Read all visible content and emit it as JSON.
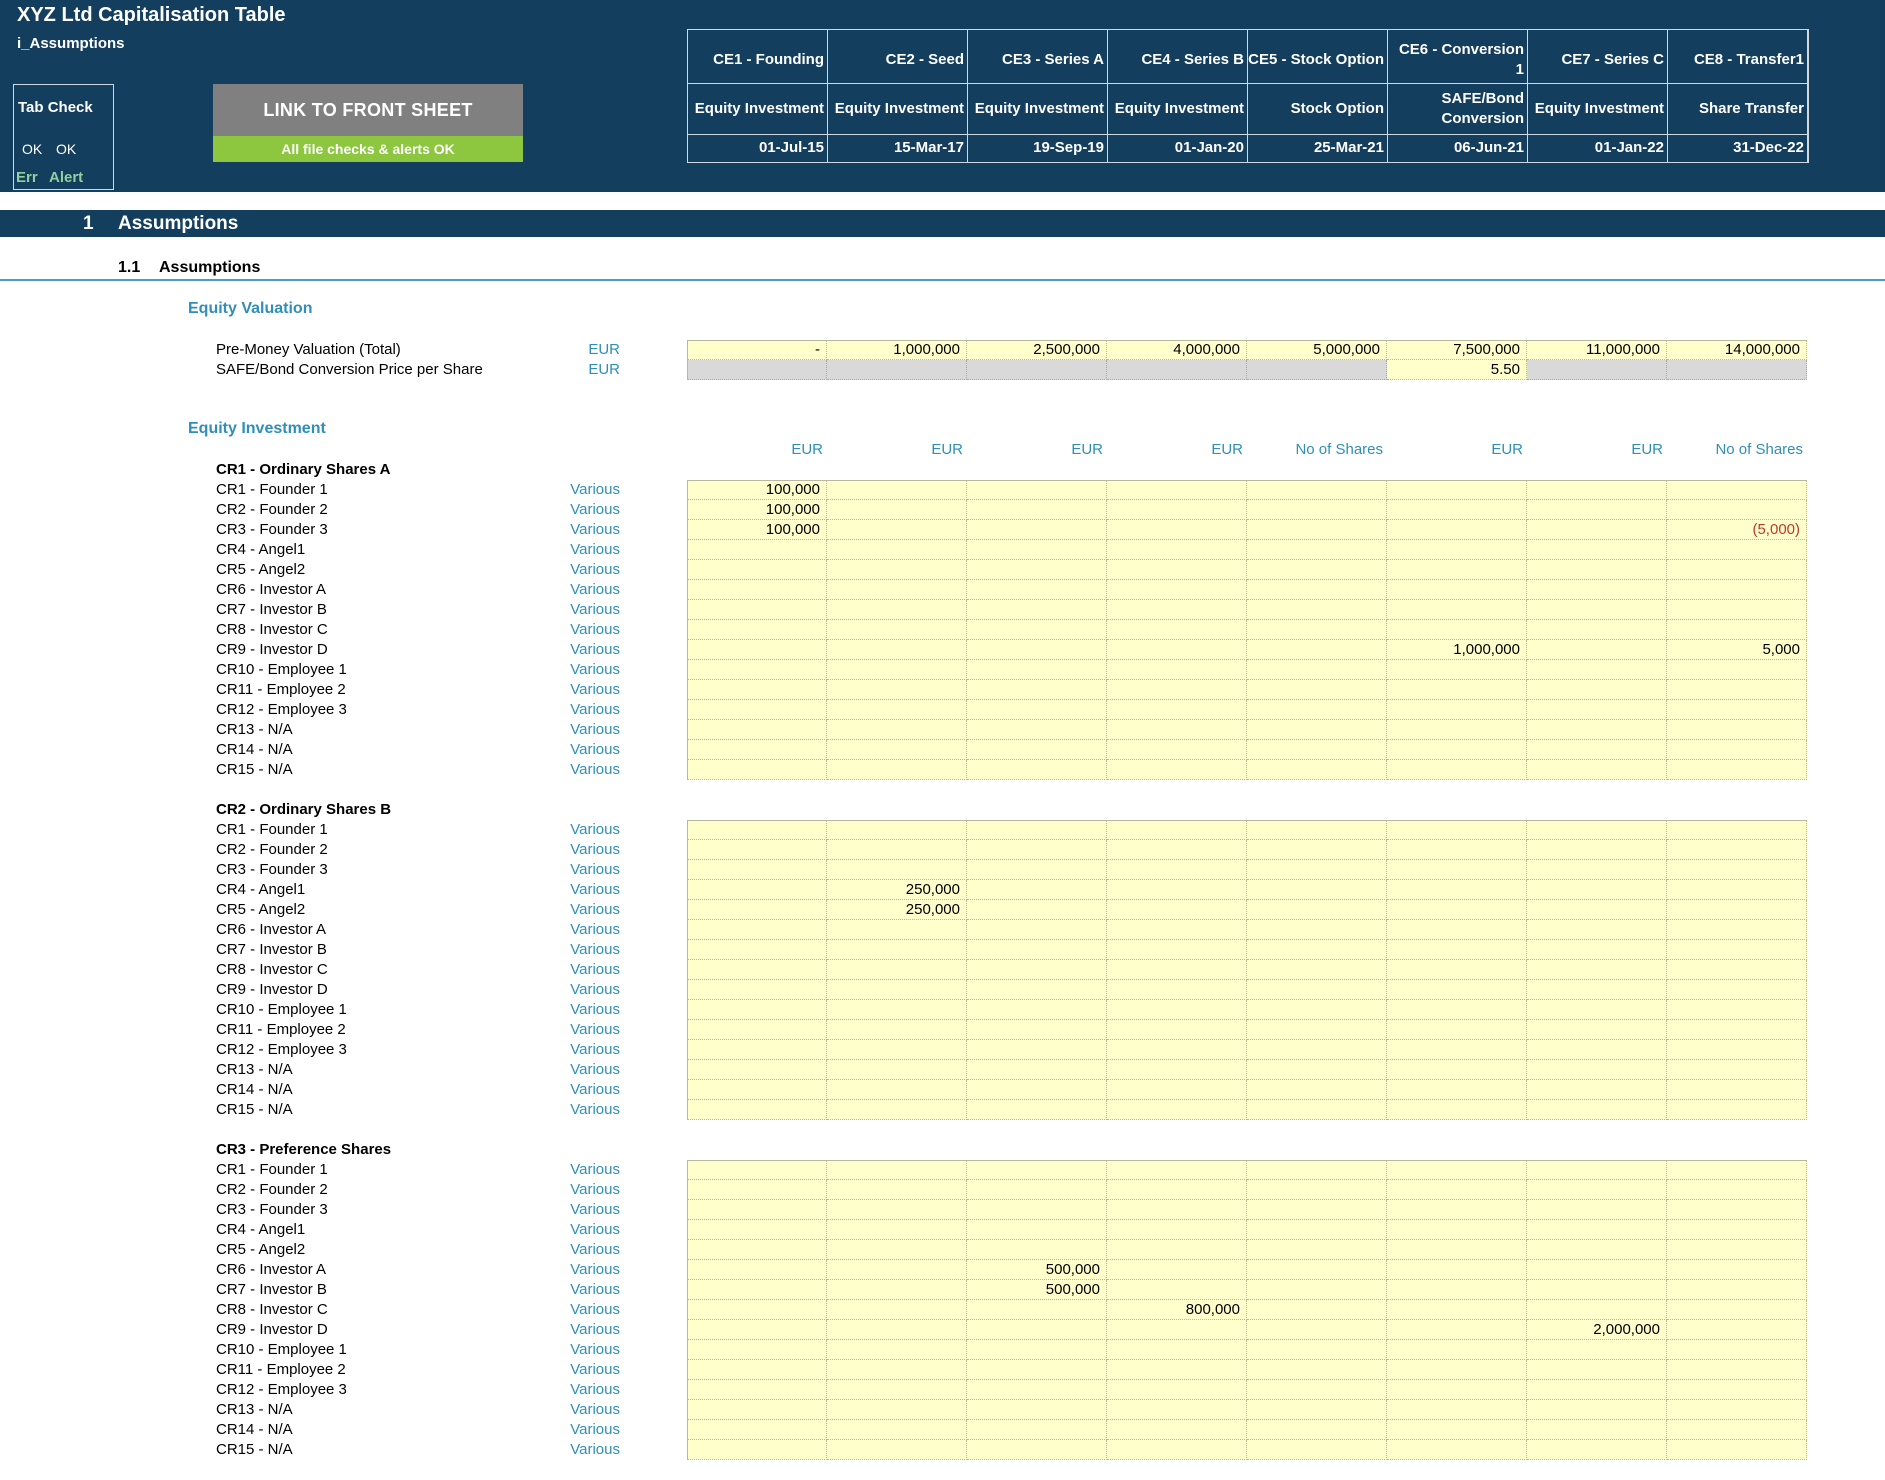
{
  "header": {
    "title": "XYZ Ltd Capitalisation Table",
    "subtitle": "i_Assumptions",
    "tab_check": {
      "label": "Tab Check",
      "ok1": "OK",
      "ok2": "OK",
      "err": "Err",
      "alert": "Alert"
    },
    "link_button": "LINK TO FRONT SHEET",
    "checks_status": "All file checks & alerts OK"
  },
  "events": [
    {
      "name": "CE1 - Founding",
      "type": "Equity Investment",
      "date": "01-Jul-15"
    },
    {
      "name": "CE2 - Seed",
      "type": "Equity Investment",
      "date": "15-Mar-17"
    },
    {
      "name": "CE3 - Series A",
      "type": "Equity Investment",
      "date": "19-Sep-19"
    },
    {
      "name": "CE4 - Series B",
      "type": "Equity Investment",
      "date": "01-Jan-20"
    },
    {
      "name": "CE5 - Stock Option",
      "type": "Stock Option",
      "date": "25-Mar-21"
    },
    {
      "name": "CE6 - Conversion\n1",
      "type": "SAFE/Bond\nConversion",
      "date": "06-Jun-21"
    },
    {
      "name": "CE7 - Series C",
      "type": "Equity Investment",
      "date": "01-Jan-22"
    },
    {
      "name": "CE8 - Transfer1",
      "type": "Share Transfer",
      "date": "31-Dec-22"
    }
  ],
  "section": {
    "number": "1",
    "title": "Assumptions",
    "sub_number": "1.1",
    "sub_title": "Assumptions"
  },
  "equity_valuation": {
    "title": "Equity Valuation",
    "rows": [
      {
        "label": "Pre-Money Valuation (Total)",
        "unit": "EUR",
        "values": [
          "-",
          "1,000,000",
          "2,500,000",
          "4,000,000",
          "5,000,000",
          "7,500,000",
          "11,000,000",
          "14,000,000"
        ]
      },
      {
        "label": "SAFE/Bond Conversion Price per Share",
        "unit": "EUR",
        "values": [
          "",
          "",
          "",
          "",
          "",
          "5.50",
          "",
          ""
        ],
        "grey": [
          true,
          true,
          true,
          true,
          true,
          false,
          true,
          true
        ]
      }
    ]
  },
  "equity_investment": {
    "title": "Equity Investment",
    "unit_headers": [
      "EUR",
      "EUR",
      "EUR",
      "EUR",
      "No of Shares",
      "EUR",
      "EUR",
      "No of Shares"
    ],
    "blocks": [
      {
        "title": "CR1 - Ordinary Shares A",
        "rows": [
          {
            "label": "CR1 - Founder 1",
            "unit": "Various",
            "values": [
              "100,000",
              "",
              "",
              "",
              "",
              "",
              "",
              ""
            ]
          },
          {
            "label": "CR2 - Founder 2",
            "unit": "Various",
            "values": [
              "100,000",
              "",
              "",
              "",
              "",
              "",
              "",
              ""
            ]
          },
          {
            "label": "CR3 - Founder 3",
            "unit": "Various",
            "values": [
              "100,000",
              "",
              "",
              "",
              "",
              "",
              "",
              "(5,000)"
            ]
          },
          {
            "label": "CR4 - Angel1",
            "unit": "Various",
            "values": [
              "",
              "",
              "",
              "",
              "",
              "",
              "",
              ""
            ]
          },
          {
            "label": "CR5 - Angel2",
            "unit": "Various",
            "values": [
              "",
              "",
              "",
              "",
              "",
              "",
              "",
              ""
            ]
          },
          {
            "label": "CR6 - Investor A",
            "unit": "Various",
            "values": [
              "",
              "",
              "",
              "",
              "",
              "",
              "",
              ""
            ]
          },
          {
            "label": "CR7 - Investor B",
            "unit": "Various",
            "values": [
              "",
              "",
              "",
              "",
              "",
              "",
              "",
              ""
            ]
          },
          {
            "label": "CR8 - Investor C",
            "unit": "Various",
            "values": [
              "",
              "",
              "",
              "",
              "",
              "",
              "",
              ""
            ]
          },
          {
            "label": "CR9 - Investor D",
            "unit": "Various",
            "values": [
              "",
              "",
              "",
              "",
              "",
              "1,000,000",
              "",
              "5,000"
            ]
          },
          {
            "label": "CR10 - Employee 1",
            "unit": "Various",
            "values": [
              "",
              "",
              "",
              "",
              "",
              "",
              "",
              ""
            ]
          },
          {
            "label": "CR11 - Employee 2",
            "unit": "Various",
            "values": [
              "",
              "",
              "",
              "",
              "",
              "",
              "",
              ""
            ]
          },
          {
            "label": "CR12 - Employee 3",
            "unit": "Various",
            "values": [
              "",
              "",
              "",
              "",
              "",
              "",
              "",
              ""
            ]
          },
          {
            "label": "CR13 - N/A",
            "unit": "Various",
            "values": [
              "",
              "",
              "",
              "",
              "",
              "",
              "",
              ""
            ]
          },
          {
            "label": "CR14 - N/A",
            "unit": "Various",
            "values": [
              "",
              "",
              "",
              "",
              "",
              "",
              "",
              ""
            ]
          },
          {
            "label": "CR15 - N/A",
            "unit": "Various",
            "values": [
              "",
              "",
              "",
              "",
              "",
              "",
              "",
              ""
            ]
          }
        ]
      },
      {
        "title": "CR2 - Ordinary Shares B",
        "rows": [
          {
            "label": "CR1 - Founder 1",
            "unit": "Various",
            "values": [
              "",
              "",
              "",
              "",
              "",
              "",
              "",
              ""
            ]
          },
          {
            "label": "CR2 - Founder 2",
            "unit": "Various",
            "values": [
              "",
              "",
              "",
              "",
              "",
              "",
              "",
              ""
            ]
          },
          {
            "label": "CR3 - Founder 3",
            "unit": "Various",
            "values": [
              "",
              "",
              "",
              "",
              "",
              "",
              "",
              ""
            ]
          },
          {
            "label": "CR4 - Angel1",
            "unit": "Various",
            "values": [
              "",
              "250,000",
              "",
              "",
              "",
              "",
              "",
              ""
            ]
          },
          {
            "label": "CR5 - Angel2",
            "unit": "Various",
            "values": [
              "",
              "250,000",
              "",
              "",
              "",
              "",
              "",
              ""
            ]
          },
          {
            "label": "CR6 - Investor A",
            "unit": "Various",
            "values": [
              "",
              "",
              "",
              "",
              "",
              "",
              "",
              ""
            ]
          },
          {
            "label": "CR7 - Investor B",
            "unit": "Various",
            "values": [
              "",
              "",
              "",
              "",
              "",
              "",
              "",
              ""
            ]
          },
          {
            "label": "CR8 - Investor C",
            "unit": "Various",
            "values": [
              "",
              "",
              "",
              "",
              "",
              "",
              "",
              ""
            ]
          },
          {
            "label": "CR9 - Investor D",
            "unit": "Various",
            "values": [
              "",
              "",
              "",
              "",
              "",
              "",
              "",
              ""
            ]
          },
          {
            "label": "CR10 - Employee 1",
            "unit": "Various",
            "values": [
              "",
              "",
              "",
              "",
              "",
              "",
              "",
              ""
            ]
          },
          {
            "label": "CR11 - Employee 2",
            "unit": "Various",
            "values": [
              "",
              "",
              "",
              "",
              "",
              "",
              "",
              ""
            ]
          },
          {
            "label": "CR12 - Employee 3",
            "unit": "Various",
            "values": [
              "",
              "",
              "",
              "",
              "",
              "",
              "",
              ""
            ]
          },
          {
            "label": "CR13 - N/A",
            "unit": "Various",
            "values": [
              "",
              "",
              "",
              "",
              "",
              "",
              "",
              ""
            ]
          },
          {
            "label": "CR14 - N/A",
            "unit": "Various",
            "values": [
              "",
              "",
              "",
              "",
              "",
              "",
              "",
              ""
            ]
          },
          {
            "label": "CR15 - N/A",
            "unit": "Various",
            "values": [
              "",
              "",
              "",
              "",
              "",
              "",
              "",
              ""
            ]
          }
        ]
      },
      {
        "title": "CR3 - Preference Shares",
        "rows": [
          {
            "label": "CR1 - Founder 1",
            "unit": "Various",
            "values": [
              "",
              "",
              "",
              "",
              "",
              "",
              "",
              ""
            ]
          },
          {
            "label": "CR2 - Founder 2",
            "unit": "Various",
            "values": [
              "",
              "",
              "",
              "",
              "",
              "",
              "",
              ""
            ]
          },
          {
            "label": "CR3 - Founder 3",
            "unit": "Various",
            "values": [
              "",
              "",
              "",
              "",
              "",
              "",
              "",
              ""
            ]
          },
          {
            "label": "CR4 - Angel1",
            "unit": "Various",
            "values": [
              "",
              "",
              "",
              "",
              "",
              "",
              "",
              ""
            ]
          },
          {
            "label": "CR5 - Angel2",
            "unit": "Various",
            "values": [
              "",
              "",
              "",
              "",
              "",
              "",
              "",
              ""
            ]
          },
          {
            "label": "CR6 - Investor A",
            "unit": "Various",
            "values": [
              "",
              "",
              "500,000",
              "",
              "",
              "",
              "",
              ""
            ]
          },
          {
            "label": "CR7 - Investor B",
            "unit": "Various",
            "values": [
              "",
              "",
              "500,000",
              "",
              "",
              "",
              "",
              ""
            ]
          },
          {
            "label": "CR8 - Investor C",
            "unit": "Various",
            "values": [
              "",
              "",
              "",
              "800,000",
              "",
              "",
              "",
              ""
            ]
          },
          {
            "label": "CR9 - Investor D",
            "unit": "Various",
            "values": [
              "",
              "",
              "",
              "",
              "",
              "",
              "2,000,000",
              ""
            ]
          },
          {
            "label": "CR10 - Employee 1",
            "unit": "Various",
            "values": [
              "",
              "",
              "",
              "",
              "",
              "",
              "",
              ""
            ]
          },
          {
            "label": "CR11 - Employee 2",
            "unit": "Various",
            "values": [
              "",
              "",
              "",
              "",
              "",
              "",
              "",
              ""
            ]
          },
          {
            "label": "CR12 - Employee 3",
            "unit": "Various",
            "values": [
              "",
              "",
              "",
              "",
              "",
              "",
              "",
              ""
            ]
          },
          {
            "label": "CR13 - N/A",
            "unit": "Various",
            "values": [
              "",
              "",
              "",
              "",
              "",
              "",
              "",
              ""
            ]
          },
          {
            "label": "CR14 - N/A",
            "unit": "Various",
            "values": [
              "",
              "",
              "",
              "",
              "",
              "",
              "",
              ""
            ]
          },
          {
            "label": "CR15 - N/A",
            "unit": "Various",
            "values": [
              "",
              "",
              "",
              "",
              "",
              "",
              "",
              ""
            ]
          }
        ]
      }
    ]
  },
  "colors": {
    "header_bg": "#133e5e",
    "input_cell": "#ffffcc",
    "disabled_cell": "#d9d9d9",
    "accent_text": "#2f8fb8",
    "ok_green": "#8dc63f",
    "negative": "#c0392b"
  }
}
